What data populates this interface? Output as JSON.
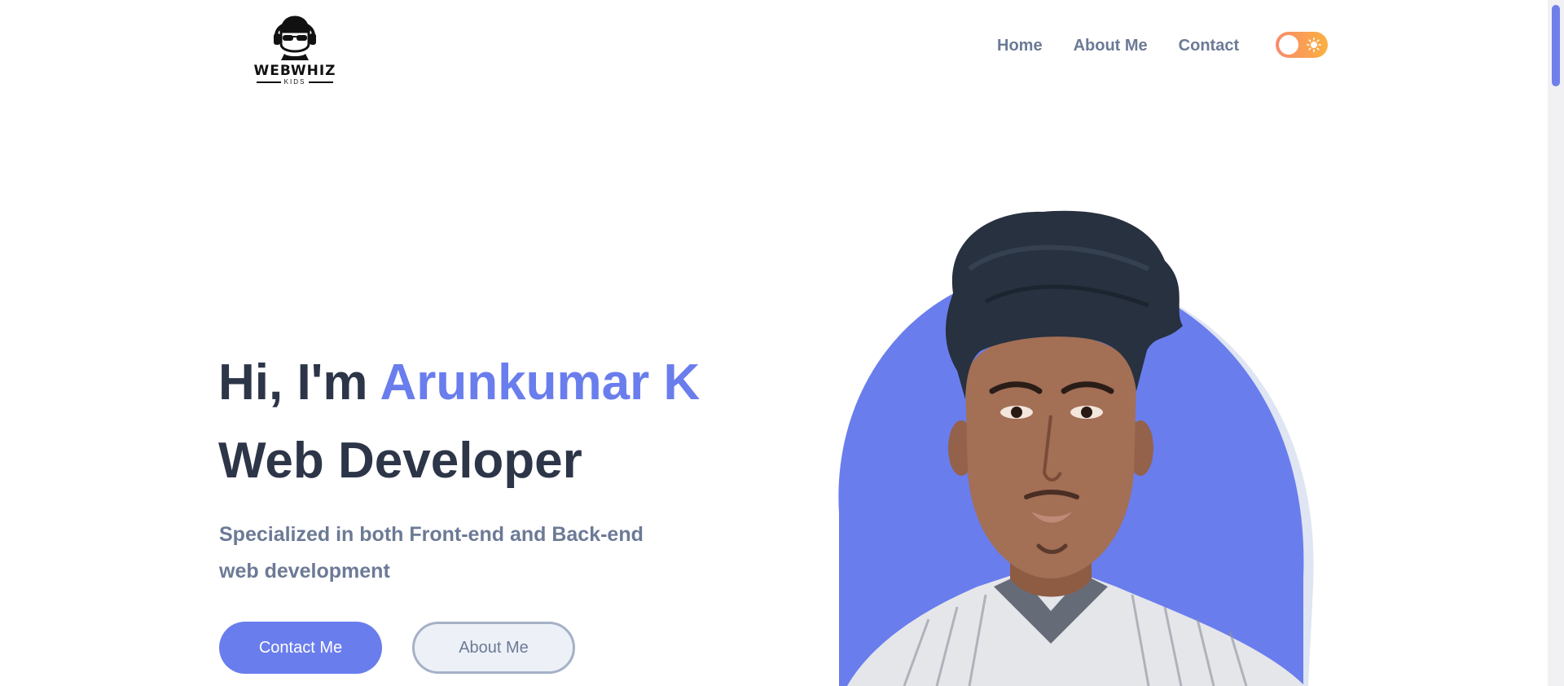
{
  "brand": {
    "logo_title": "WEBWHIZ",
    "logo_subtitle": "KIDS",
    "logo_icon": "kid-with-cap-and-sunglasses-logo"
  },
  "nav": {
    "items": [
      {
        "label": "Home"
      },
      {
        "label": "About Me"
      },
      {
        "label": "Contact"
      }
    ],
    "theme_toggle": {
      "state": "light",
      "icon": "sun-icon"
    }
  },
  "hero": {
    "greeting": "Hi, I'm",
    "name": "Arunkumar K",
    "role": "Web Developer",
    "description": "Specialized in both Front-end and Back-end web development",
    "primary_button": "Contact Me",
    "secondary_button": "About Me",
    "photo": "portrait-photo"
  },
  "colors": {
    "accent": "#6a7ded",
    "heading": "#2d3548",
    "muted": "#6c7a96",
    "toggle_start": "#f78b6b",
    "toggle_end": "#fbb040"
  }
}
